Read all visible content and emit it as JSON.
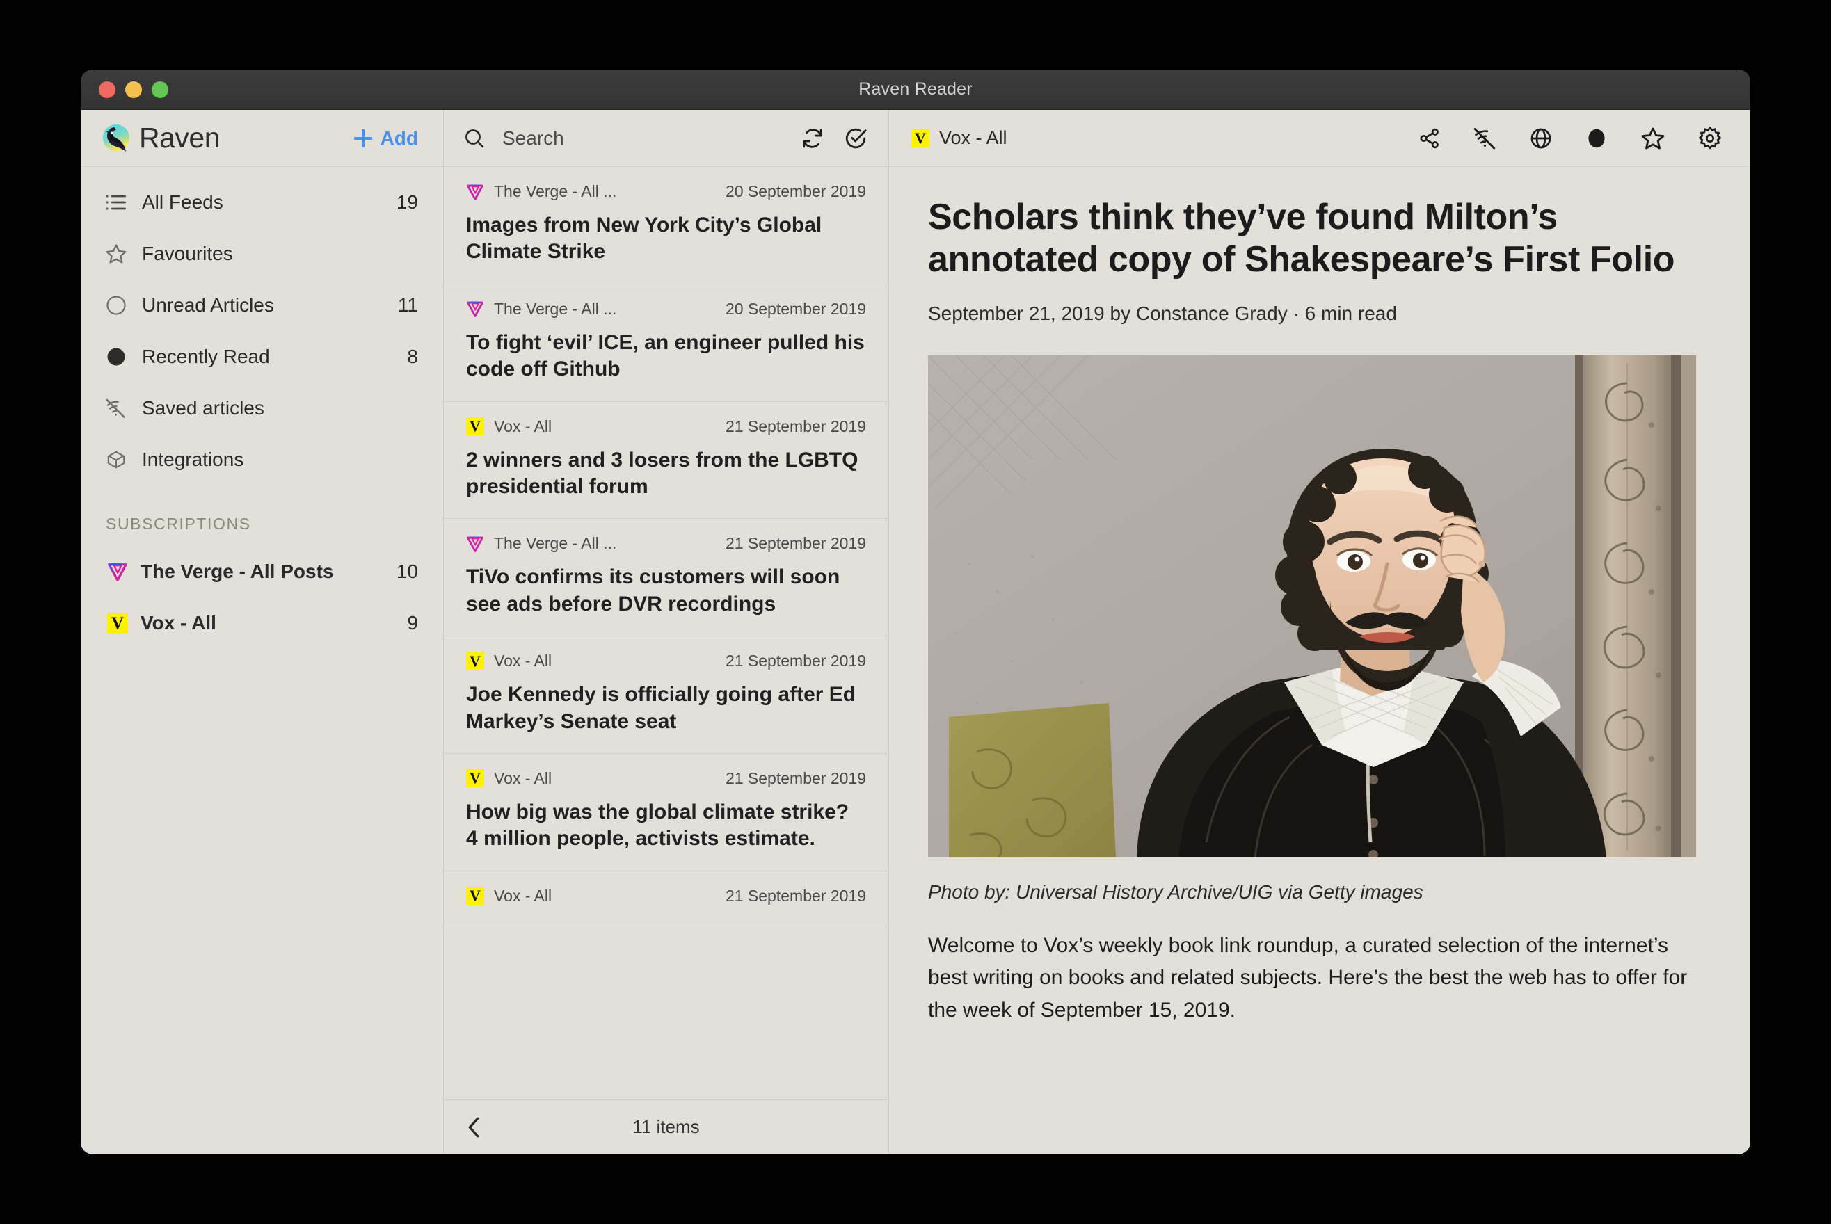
{
  "window": {
    "title": "Raven Reader",
    "traffic_lights": [
      "close",
      "minimize",
      "maximize"
    ]
  },
  "sidebar": {
    "brand": "Raven",
    "add_label": "Add",
    "nav": [
      {
        "icon": "list-icon",
        "label": "All Feeds",
        "count": "19"
      },
      {
        "icon": "star-outline-icon",
        "label": "Favourites",
        "count": ""
      },
      {
        "icon": "circle-outline-icon",
        "label": "Unread Articles",
        "count": "11"
      },
      {
        "icon": "circle-filled-icon",
        "label": "Recently Read",
        "count": "8"
      },
      {
        "icon": "wifi-off-icon",
        "label": "Saved articles",
        "count": ""
      },
      {
        "icon": "box-icon",
        "label": "Integrations",
        "count": ""
      }
    ],
    "subscriptions_title": "SUBSCRIPTIONS",
    "subscriptions": [
      {
        "favicon": "verge-favicon",
        "label": "The Verge - All Posts",
        "count": "10"
      },
      {
        "favicon": "vox-favicon",
        "label": "Vox - All",
        "count": "9"
      }
    ]
  },
  "search": {
    "placeholder": "Search",
    "value": "",
    "icons": [
      "search-icon",
      "refresh-icon",
      "mark-all-read-icon"
    ]
  },
  "article_list": {
    "items": [
      {
        "favicon": "verge-favicon",
        "feed": "The Verge - All ...",
        "date": "20 September 2019",
        "title": "Images from New York City’s Global Climate Strike"
      },
      {
        "favicon": "verge-favicon",
        "feed": "The Verge - All ...",
        "date": "20 September 2019",
        "title": "To fight ‘evil’ ICE, an engineer pulled his code off Github"
      },
      {
        "favicon": "vox-favicon",
        "feed": "Vox - All",
        "date": "21 September 2019",
        "title": "2 winners and 3 losers from the LGBTQ presidential forum"
      },
      {
        "favicon": "verge-favicon",
        "feed": "The Verge - All ...",
        "date": "21 September 2019",
        "title": "TiVo confirms its customers will soon see ads before DVR recordings"
      },
      {
        "favicon": "vox-favicon",
        "feed": "Vox - All",
        "date": "21 September 2019",
        "title": "Joe Kennedy is officially going after Ed Markey’s Senate seat"
      },
      {
        "favicon": "vox-favicon",
        "feed": "Vox - All",
        "date": "21 September 2019",
        "title": "How big was the global climate strike? 4 million people, activists estimate."
      },
      {
        "favicon": "vox-favicon",
        "feed": "Vox - All",
        "date": "21 September 2019",
        "title": ""
      }
    ],
    "footer_count": "11 items",
    "back_icon": "chevron-left-icon"
  },
  "reader": {
    "feed_label": "Vox - All",
    "feed_favicon": "vox-favicon",
    "toolbar_icons": [
      "share-icon",
      "wifi-off-icon",
      "globe-icon",
      "circle-filled-icon",
      "star-outline-icon",
      "gear-icon"
    ],
    "headline": "Scholars think they’ve found Milton’s annotated copy of Shakespeare’s First Folio",
    "byline": "September 21, 2019 by Constance Grady · 6 min read",
    "image_alt": "shakespeare-portrait",
    "caption": "Photo by: Universal History Archive/UIG via Getty images",
    "paragraph": "Welcome to Vox’s weekly book link roundup, a curated selection of the internet’s best writing on books and related subjects. Here’s the best the web has to offer for the week of September 15, 2019."
  },
  "colors": {
    "app_background": "#e3e0da",
    "titlebar": "#3c3c3c",
    "accent_blue": "#4a90f0",
    "vox_yellow": "#fff200",
    "verge_magenta": "#e02f93",
    "text_primary": "#1e1e1e",
    "text_muted": "#8b8880"
  }
}
